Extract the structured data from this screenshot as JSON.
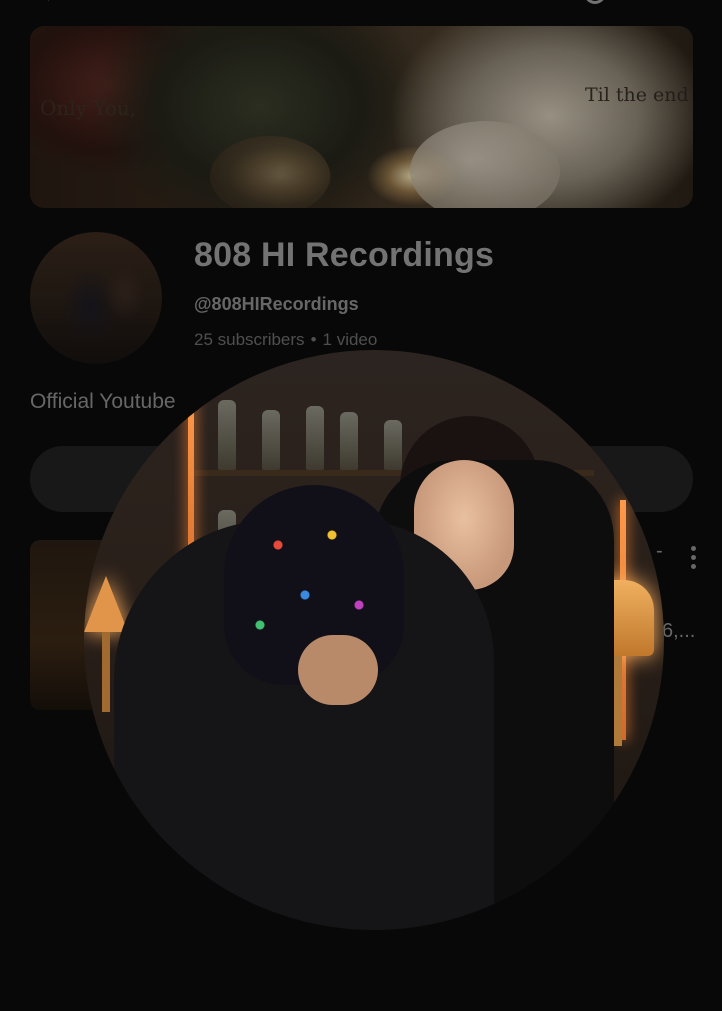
{
  "banner": {
    "text_left": "Only You,",
    "text_right": "Til the end"
  },
  "channel": {
    "name": "808 HI Recordings",
    "handle": "@808HIRecordings",
    "subscribers": "25 subscribers",
    "separator": "•",
    "videos": "1 video",
    "description_partial": "Official Youtube"
  },
  "video": {
    "meta_fragment": "6,...",
    "dash": "-"
  },
  "icons": {
    "back": "back-arrow-icon",
    "cast": "cast-icon",
    "search": "search-icon",
    "more": "more-vertical-icon"
  }
}
